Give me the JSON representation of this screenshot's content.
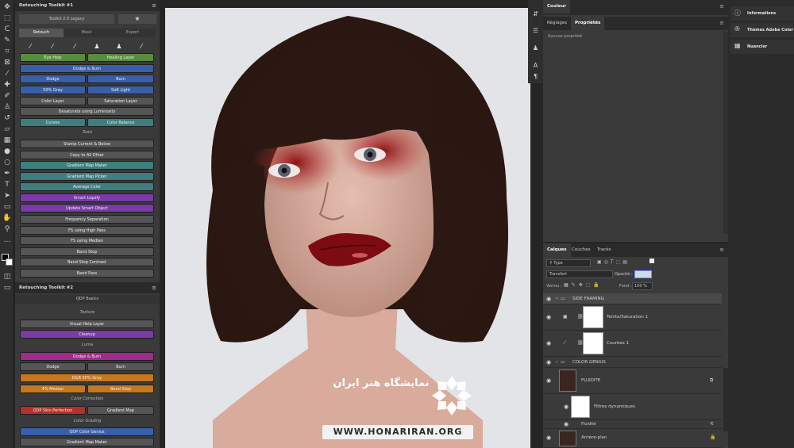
{
  "tools_panel": {
    "icons": [
      "move-tool-icon",
      "marquee-tool-icon",
      "lasso-tool-icon",
      "quick-select-icon",
      "crop-tool-icon",
      "frame-tool-icon",
      "eyedropper-icon",
      "healing-brush-icon",
      "brush-tool-icon",
      "clone-stamp-icon",
      "history-brush-icon",
      "eraser-icon",
      "gradient-tool-icon",
      "blur-tool-icon",
      "dodge-tool-icon",
      "pen-tool-icon",
      "type-tool-icon",
      "path-select-icon",
      "shape-tool-icon",
      "hand-tool-icon",
      "zoom-tool-icon",
      "more-tools-icon"
    ]
  },
  "toolkit1": {
    "title": "Retouching Toolkit #1",
    "subheader": "Toolkit 2.0 Legacy",
    "tabs": [
      "Retouch",
      "Mask",
      "Expert"
    ],
    "buttons": [
      {
        "label": "Eye Help",
        "color": "green"
      },
      {
        "label": "Healing Layer",
        "color": "green"
      },
      {
        "label": "Dodge & Burn",
        "color": "blue"
      },
      {
        "label": "Dodge",
        "color": "blue"
      },
      {
        "label": "Burn",
        "color": "blue"
      },
      {
        "label": "50% Gray",
        "color": "blue"
      },
      {
        "label": "Soft Light",
        "color": "blue"
      },
      {
        "label": "Color Layer",
        "color": "gray"
      },
      {
        "label": "Saturation Layer",
        "color": "gray"
      },
      {
        "label": "Desaturate using Luminosity",
        "color": "gray"
      },
      {
        "label": "Curves",
        "color": "teal"
      },
      {
        "label": "Color Balance",
        "color": "teal"
      }
    ],
    "tools_label": "Tools",
    "tools_buttons": [
      {
        "label": "Stamp Current & Below",
        "color": "gray"
      },
      {
        "label": "Copy to All Other",
        "color": "gray"
      },
      {
        "label": "Gradient Map Maker",
        "color": "teal"
      },
      {
        "label": "Gradient Map Picker",
        "color": "teal"
      },
      {
        "label": "Average Color",
        "color": "teal"
      },
      {
        "label": "Smart Liquify",
        "color": "purple"
      },
      {
        "label": "Update Smart Object",
        "color": "purple"
      },
      {
        "label": "Frequency Separation",
        "color": "gray"
      },
      {
        "label": "FS using High Pass",
        "color": "gray"
      },
      {
        "label": "FS using Median",
        "color": "gray"
      },
      {
        "label": "Band Stop",
        "color": "gray"
      },
      {
        "label": "Band Stop Contrast",
        "color": "gray"
      },
      {
        "label": "Band Pass",
        "color": "gray"
      }
    ]
  },
  "toolkit2": {
    "title": "Retouching Toolkit #2",
    "header": "QDP Basics",
    "texture_label": "Texture",
    "texture_buttons": [
      "Visual Help Layer",
      "Cleanup"
    ],
    "luma_label": "Luma",
    "luma_buttons": [
      "Dodge & Burn",
      "Dodge",
      "Burn",
      "D&B 50% Gray",
      "4% Median",
      "Band Stop"
    ],
    "cc_label": "Color Correction",
    "cc_buttons": [
      "QDP Skin Perfection",
      "Gradient Map"
    ],
    "cg_label": "Color Grading",
    "cg_buttons": [
      "QDP Color Genius",
      "Gradient Map Maker"
    ]
  },
  "watermark": {
    "persian": "نمایشگاه هنر ایران",
    "url": "WWW.HONARIRAN.ORG"
  },
  "properties_panel": {
    "title": "Couleur",
    "tabs": [
      "Réglages",
      "Propriétés"
    ],
    "active_tab": "Propriétés",
    "empty_text": "Aucune propriété"
  },
  "layers_panel": {
    "tabs": [
      "Calques",
      "Couches",
      "Tracés"
    ],
    "filter_label": "Type",
    "blend_mode": "Transfert",
    "opacity_label": "Opacité :",
    "opacity_value": "",
    "lock_label": "Verrou :",
    "fill_label": "Fond :",
    "fill_value": "100 %",
    "layers": [
      {
        "name": "SIDE FRAMING",
        "kind": "group"
      },
      {
        "name": "Teinte/Saturation 1",
        "kind": "adjustment"
      },
      {
        "name": "Courbes 1",
        "kind": "adjustment"
      },
      {
        "name": "COLOR GENIUS",
        "kind": "group"
      },
      {
        "name": "FLUIDITE",
        "kind": "smart-object"
      },
      {
        "name": "Filtres dynamiques",
        "kind": "filter"
      },
      {
        "name": "Fluidité",
        "kind": "filter-item"
      },
      {
        "name": "Arrière-plan",
        "kind": "background"
      }
    ]
  },
  "far_panel": {
    "items": [
      {
        "label": "Informations",
        "icon": "info-icon"
      },
      {
        "label": "Thèmes Adobe Color",
        "icon": "color-themes-icon"
      },
      {
        "label": "Nuancier",
        "icon": "swatches-icon"
      }
    ]
  },
  "colors": {
    "green": "#5b8a3c",
    "blue": "#3a5fa8",
    "gray": "#555555",
    "teal": "#3f7e7c",
    "purple": "#7a3aa8",
    "magenta": "#a12a8e",
    "orange": "#c6781e",
    "red": "#b0322a"
  }
}
